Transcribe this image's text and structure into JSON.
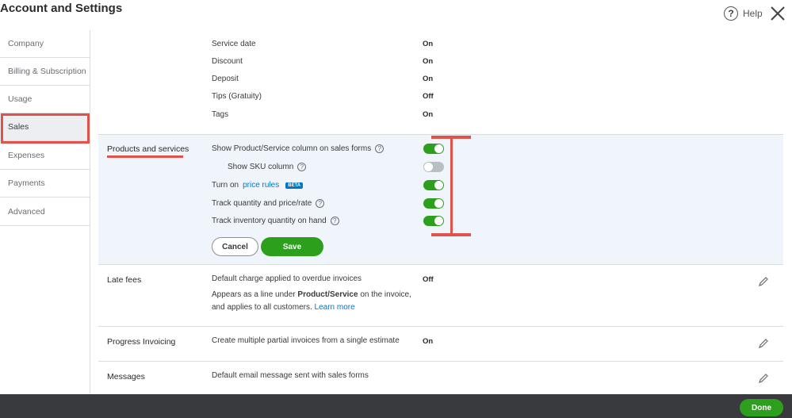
{
  "header": {
    "title": "Account and Settings",
    "help_label": "Help"
  },
  "sidebar": {
    "items": [
      {
        "label": "Company"
      },
      {
        "label": "Billing & Subscription"
      },
      {
        "label": "Usage"
      },
      {
        "label": "Sales"
      },
      {
        "label": "Expenses"
      },
      {
        "label": "Payments"
      },
      {
        "label": "Advanced"
      }
    ],
    "active": "Sales"
  },
  "sales_form": {
    "rows": [
      {
        "label": "Service date",
        "value": "On"
      },
      {
        "label": "Discount",
        "value": "On"
      },
      {
        "label": "Deposit",
        "value": "On"
      },
      {
        "label": "Tips (Gratuity)",
        "value": "Off"
      },
      {
        "label": "Tags",
        "value": "On"
      }
    ]
  },
  "products": {
    "title": "Products and services",
    "options": [
      {
        "label": "Show Product/Service column on sales forms",
        "enabled": true
      },
      {
        "label": "Show SKU column",
        "enabled": false
      },
      {
        "label_prefix": "Turn on",
        "link": "price rules",
        "badge": "BETA",
        "enabled": true
      },
      {
        "label": "Track quantity and price/rate",
        "enabled": true
      },
      {
        "label": "Track inventory quantity on hand",
        "enabled": true
      }
    ],
    "cancel_label": "Cancel",
    "save_label": "Save"
  },
  "late_fees": {
    "title": "Late fees",
    "description": "Default charge applied to overdue invoices",
    "value": "Off",
    "note_prefix": "Appears as a line under",
    "note_bold": "Product/Service",
    "note_mid": "on the invoice,",
    "note_line2": "and applies to all customers.",
    "note_link": "Learn more"
  },
  "progress": {
    "title": "Progress Invoicing",
    "description": "Create multiple partial invoices from a single estimate",
    "value": "On"
  },
  "messages": {
    "title": "Messages",
    "description": "Default email message sent with sales forms"
  },
  "footer": {
    "done_label": "Done"
  },
  "colors": {
    "accent_green": "#2ca01c",
    "annotation_red": "#e0524a",
    "link_blue": "#0077c5"
  }
}
